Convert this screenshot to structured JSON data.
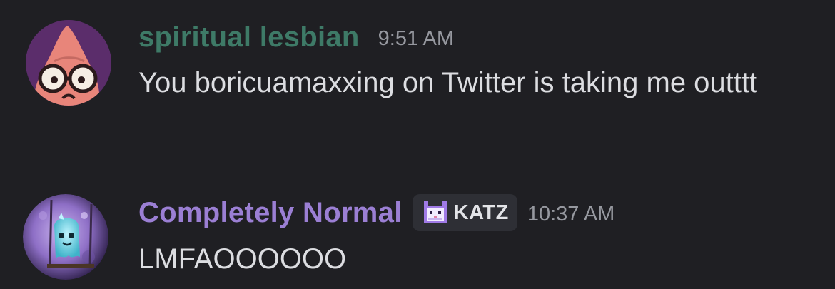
{
  "messages": [
    {
      "username": "spiritual lesbian",
      "username_color": "#3e7a67",
      "timestamp": "9:51 AM",
      "content": "You boricuamaxxing on Twitter is taking me outttt",
      "avatar_icon": "patrick-star-glasses-avatar"
    },
    {
      "username": "Completely Normal",
      "username_color": "#9b7fd4",
      "badge": {
        "icon": "pixel-cat-icon",
        "label": "KATZ"
      },
      "timestamp": "10:37 AM",
      "content": "LMFAOOOOOO",
      "avatar_icon": "ghost-moon-avatar"
    }
  ]
}
